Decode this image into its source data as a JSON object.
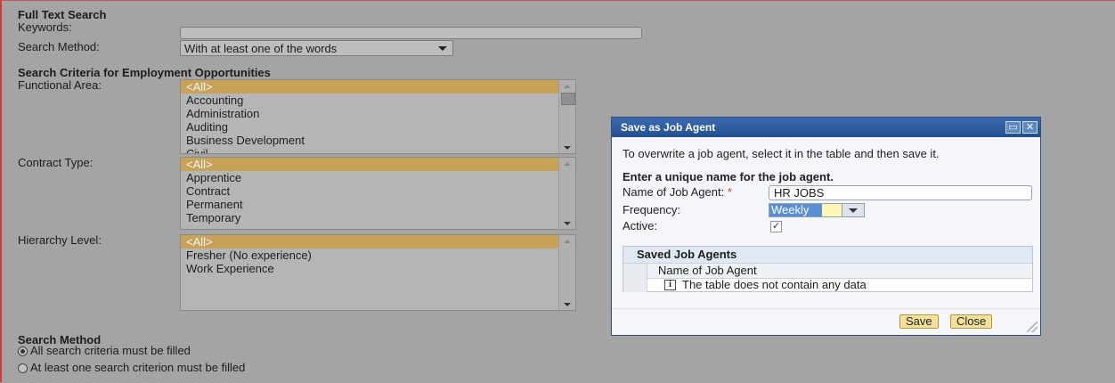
{
  "full_text_search": {
    "title": "Full Text Search",
    "keywords_label": "Keywords:",
    "keywords_value": "",
    "search_method_label": "Search Method:",
    "search_method_value": "With at least one of the words"
  },
  "criteria": {
    "title": "Search Criteria for Employment Opportunities",
    "functional_area": {
      "label": "Functional Area:",
      "options": [
        "<All>",
        "Accounting",
        "Administration",
        "Auditing",
        "Business Development",
        "Civil"
      ]
    },
    "contract_type": {
      "label": "Contract Type:",
      "options": [
        "<All>",
        "Apprentice",
        "Contract",
        "Permanent",
        "Temporary"
      ]
    },
    "hierarchy_level": {
      "label": "Hierarchy Level:",
      "options": [
        "<All>",
        "Fresher (No experience)",
        "Work Experience"
      ]
    }
  },
  "search_method": {
    "title": "Search Method",
    "options": [
      "All search criteria must be filled",
      "At least one search criterion must be filled"
    ],
    "selected": 0
  },
  "dialog": {
    "title": "Save as Job Agent",
    "instruction": "To overwrite a job agent, select it in the table and then save it.",
    "subtitle": "Enter a unique name for the job agent.",
    "name_label": "Name of Job Agent:",
    "required_marker": "*",
    "name_value": "HR JOBS",
    "frequency_label": "Frequency:",
    "frequency_value": "Weekly",
    "active_label": "Active:",
    "active_checked": true,
    "active_check_glyph": "✓",
    "table": {
      "title": "Saved Job Agents",
      "column": "Name of Job Agent",
      "empty_message": "The table does not contain any data",
      "info_glyph": "i"
    },
    "save_label": "Save",
    "close_label": "Close"
  },
  "colors": {
    "background": "#a4a4a4",
    "selected_option": "#c9a25a",
    "dialog_title": "#2c5a9a",
    "dialog_button": "#f4e09a"
  }
}
